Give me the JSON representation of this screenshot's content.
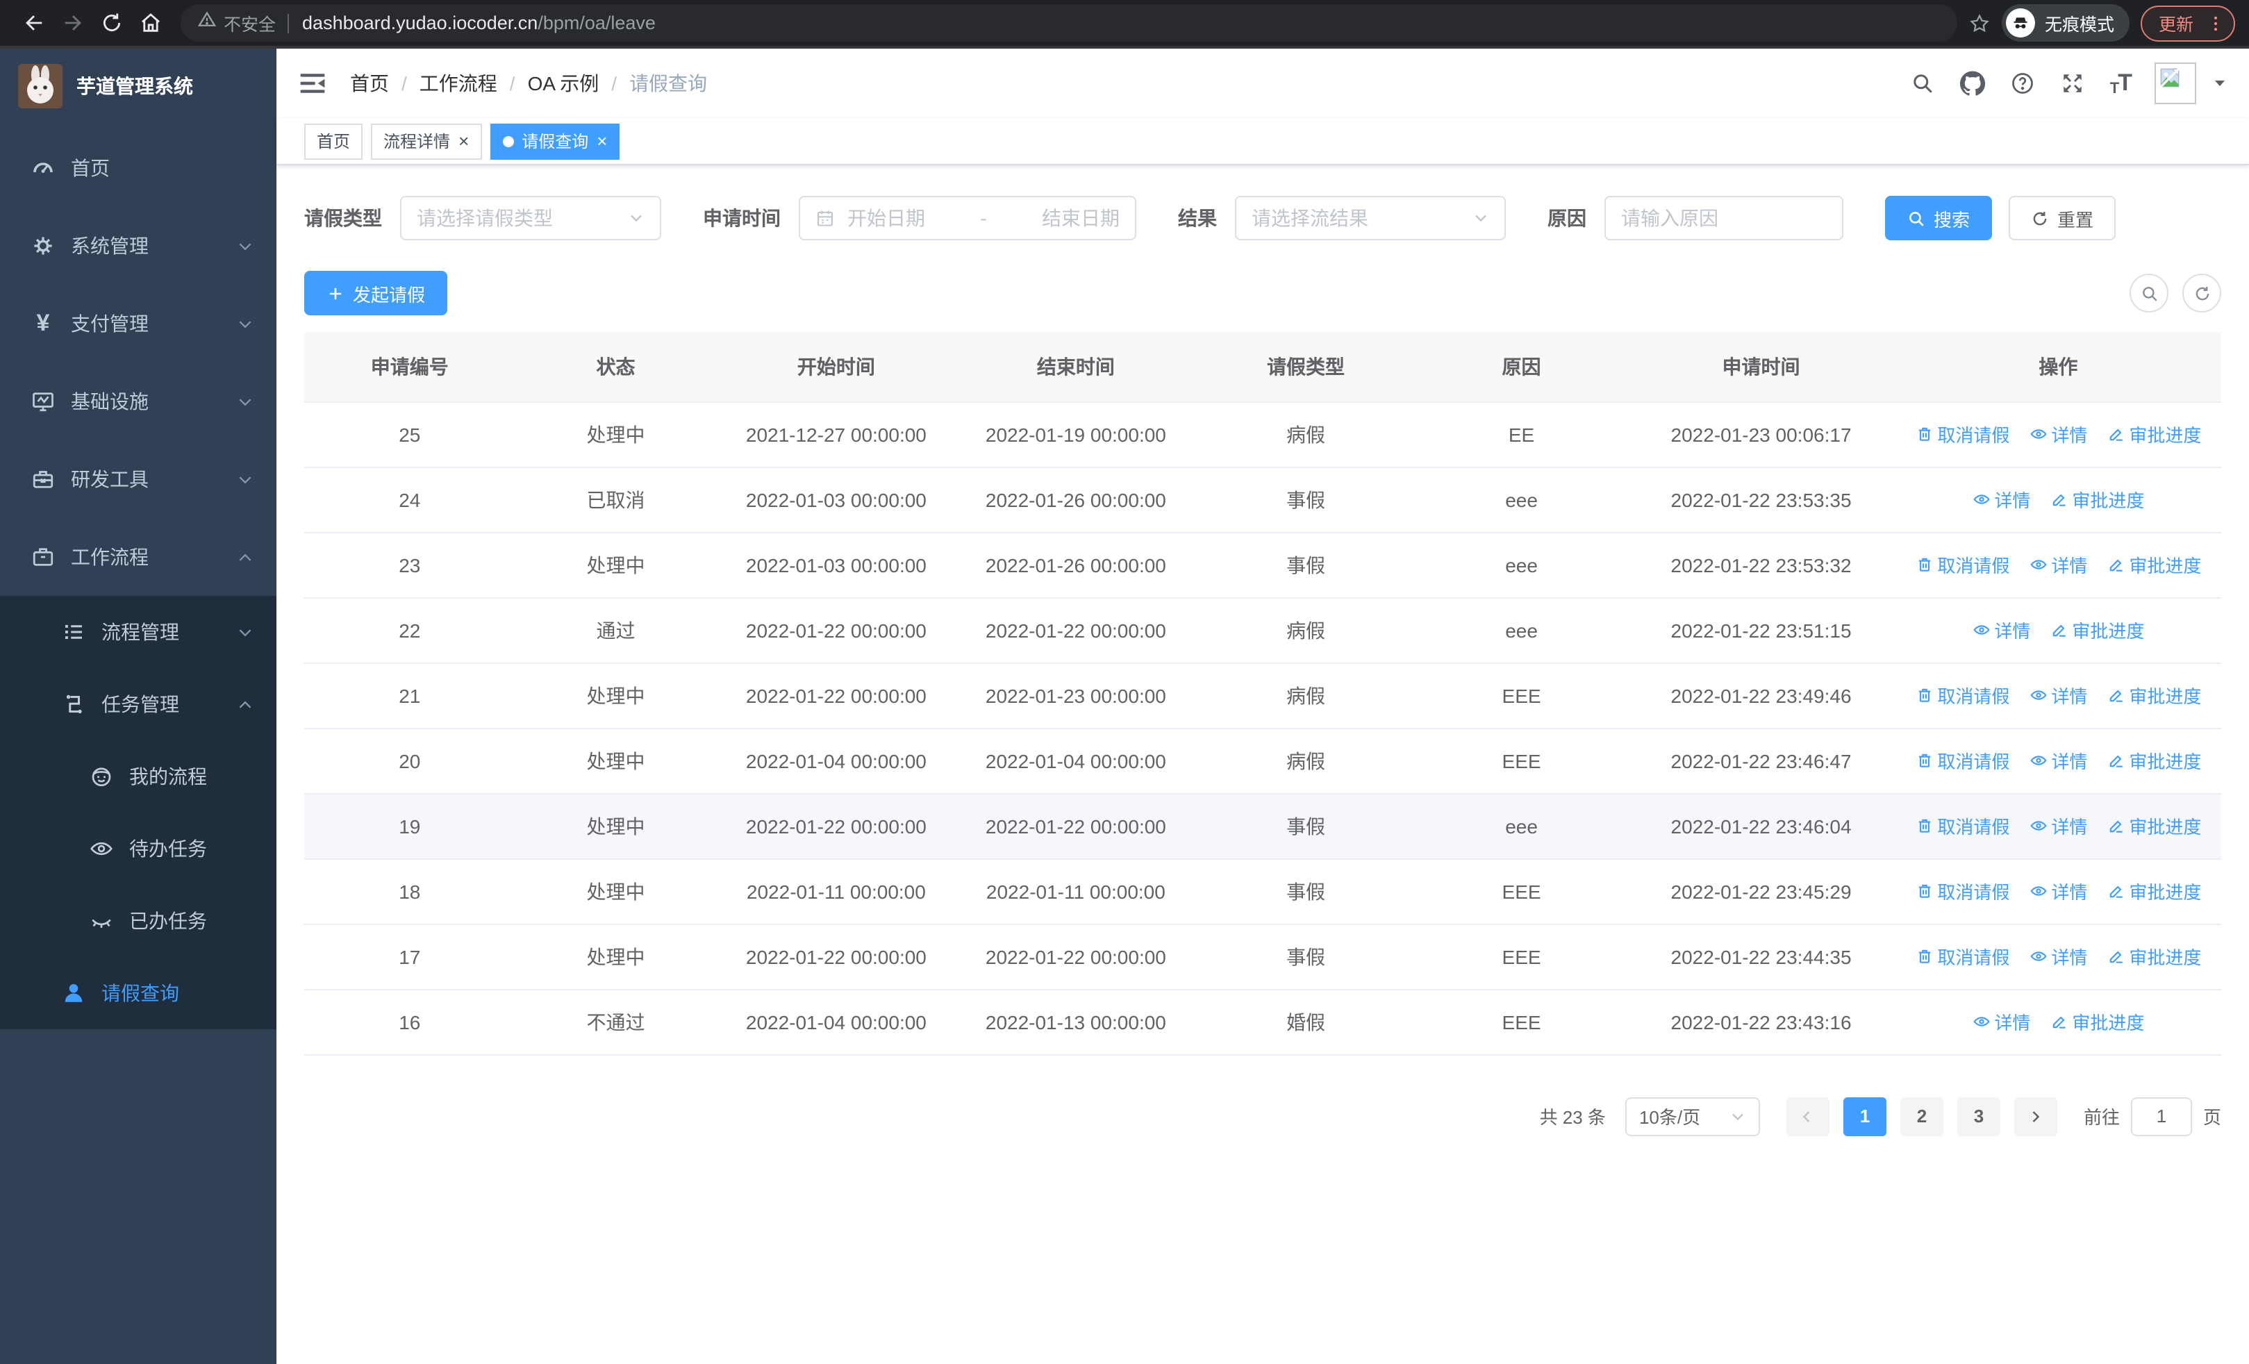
{
  "colors": {
    "accent": "#409eff",
    "sidebar_bg": "#304156",
    "submenu_bg": "#1f2d3d",
    "sidebar_text": "#bfcbd9"
  },
  "browser": {
    "security_label": "不安全",
    "url_host": "dashboard.yudao.iocoder.cn",
    "url_path": "/bpm/oa/leave",
    "incognito_label": "无痕模式",
    "update_label": "更新"
  },
  "sidebar": {
    "title": "芋道管理系统",
    "items": [
      {
        "id": "home",
        "label": "首页",
        "icon": "dashboard-icon",
        "level": 1,
        "sub": false,
        "chevron": "",
        "active": false
      },
      {
        "id": "system",
        "label": "系统管理",
        "icon": "gear-icon",
        "level": 1,
        "sub": false,
        "chevron": "down",
        "active": false
      },
      {
        "id": "payment",
        "label": "支付管理",
        "icon": "yen-icon",
        "level": 1,
        "sub": false,
        "chevron": "down",
        "active": false
      },
      {
        "id": "infra",
        "label": "基础设施",
        "icon": "monitor-icon",
        "level": 1,
        "sub": false,
        "chevron": "down",
        "active": false
      },
      {
        "id": "devtools",
        "label": "研发工具",
        "icon": "toolbox-icon",
        "level": 1,
        "sub": false,
        "chevron": "down",
        "active": false
      },
      {
        "id": "workflow",
        "label": "工作流程",
        "icon": "briefcase-icon",
        "level": 1,
        "sub": false,
        "chevron": "up",
        "active": false
      },
      {
        "id": "process-mgmt",
        "label": "流程管理",
        "icon": "list-icon",
        "level": 2,
        "sub": true,
        "chevron": "down",
        "active": false
      },
      {
        "id": "task-mgmt",
        "label": "任务管理",
        "icon": "flow-icon",
        "level": 2,
        "sub": true,
        "chevron": "up",
        "active": false
      },
      {
        "id": "my-process",
        "label": "我的流程",
        "icon": "face-icon",
        "level": 3,
        "sub": true,
        "chevron": "",
        "active": false
      },
      {
        "id": "todo-task",
        "label": "待办任务",
        "icon": "eye-open-icon",
        "level": 3,
        "sub": true,
        "chevron": "",
        "active": false
      },
      {
        "id": "done-task",
        "label": "已办任务",
        "icon": "eye-closed-icon",
        "level": 3,
        "sub": true,
        "chevron": "",
        "active": false
      },
      {
        "id": "leave-query",
        "label": "请假查询",
        "icon": "user-icon",
        "level": 2,
        "sub": true,
        "chevron": "",
        "active": true
      }
    ]
  },
  "navbar": {
    "breadcrumb": [
      "首页",
      "工作流程",
      "OA 示例",
      "请假查询"
    ],
    "breadcrumb_separator": "/"
  },
  "tags": {
    "tabs": [
      {
        "label": "首页",
        "active": false,
        "closable": false
      },
      {
        "label": "流程详情",
        "active": false,
        "closable": true
      },
      {
        "label": "请假查询",
        "active": true,
        "closable": true
      }
    ]
  },
  "filters": {
    "leave_type": {
      "label": "请假类型",
      "placeholder": "请选择请假类型"
    },
    "apply_time": {
      "label": "申请时间",
      "start_placeholder": "开始日期",
      "separator": "-",
      "end_placeholder": "结束日期"
    },
    "result": {
      "label": "结果",
      "placeholder": "请选择流结果"
    },
    "reason": {
      "label": "原因",
      "placeholder": "请输入原因"
    },
    "search_label": "搜索",
    "reset_label": "重置"
  },
  "toolbar": {
    "create_label": "发起请假"
  },
  "table": {
    "headers": [
      "申请编号",
      "状态",
      "开始时间",
      "结束时间",
      "请假类型",
      "原因",
      "申请时间",
      "操作"
    ],
    "action_labels": {
      "cancel": "取消请假",
      "detail": "详情",
      "progress": "审批进度"
    },
    "rows": [
      {
        "id": "25",
        "status": "处理中",
        "start": "2021-12-27 00:00:00",
        "end": "2022-01-19 00:00:00",
        "type": "病假",
        "reason": "EE",
        "applied": "2022-01-23 00:06:17",
        "actions": [
          "cancel",
          "detail",
          "progress"
        ],
        "highlight": false
      },
      {
        "id": "24",
        "status": "已取消",
        "start": "2022-01-03 00:00:00",
        "end": "2022-01-26 00:00:00",
        "type": "事假",
        "reason": "eee",
        "applied": "2022-01-22 23:53:35",
        "actions": [
          "detail",
          "progress"
        ],
        "highlight": false
      },
      {
        "id": "23",
        "status": "处理中",
        "start": "2022-01-03 00:00:00",
        "end": "2022-01-26 00:00:00",
        "type": "事假",
        "reason": "eee",
        "applied": "2022-01-22 23:53:32",
        "actions": [
          "cancel",
          "detail",
          "progress"
        ],
        "highlight": false
      },
      {
        "id": "22",
        "status": "通过",
        "start": "2022-01-22 00:00:00",
        "end": "2022-01-22 00:00:00",
        "type": "病假",
        "reason": "eee",
        "applied": "2022-01-22 23:51:15",
        "actions": [
          "detail",
          "progress"
        ],
        "highlight": false
      },
      {
        "id": "21",
        "status": "处理中",
        "start": "2022-01-22 00:00:00",
        "end": "2022-01-23 00:00:00",
        "type": "病假",
        "reason": "EEE",
        "applied": "2022-01-22 23:49:46",
        "actions": [
          "cancel",
          "detail",
          "progress"
        ],
        "highlight": false
      },
      {
        "id": "20",
        "status": "处理中",
        "start": "2022-01-04 00:00:00",
        "end": "2022-01-04 00:00:00",
        "type": "病假",
        "reason": "EEE",
        "applied": "2022-01-22 23:46:47",
        "actions": [
          "cancel",
          "detail",
          "progress"
        ],
        "highlight": false
      },
      {
        "id": "19",
        "status": "处理中",
        "start": "2022-01-22 00:00:00",
        "end": "2022-01-22 00:00:00",
        "type": "事假",
        "reason": "eee",
        "applied": "2022-01-22 23:46:04",
        "actions": [
          "cancel",
          "detail",
          "progress"
        ],
        "highlight": true
      },
      {
        "id": "18",
        "status": "处理中",
        "start": "2022-01-11 00:00:00",
        "end": "2022-01-11 00:00:00",
        "type": "事假",
        "reason": "EEE",
        "applied": "2022-01-22 23:45:29",
        "actions": [
          "cancel",
          "detail",
          "progress"
        ],
        "highlight": false
      },
      {
        "id": "17",
        "status": "处理中",
        "start": "2022-01-22 00:00:00",
        "end": "2022-01-22 00:00:00",
        "type": "事假",
        "reason": "EEE",
        "applied": "2022-01-22 23:44:35",
        "actions": [
          "cancel",
          "detail",
          "progress"
        ],
        "highlight": false
      },
      {
        "id": "16",
        "status": "不通过",
        "start": "2022-01-04 00:00:00",
        "end": "2022-01-13 00:00:00",
        "type": "婚假",
        "reason": "EEE",
        "applied": "2022-01-22 23:43:16",
        "actions": [
          "detail",
          "progress"
        ],
        "highlight": false
      }
    ],
    "column_widths": [
      "11%",
      "10.5%",
      "12.5%",
      "12.5%",
      "11.5%",
      "11%",
      "14%",
      "17%"
    ]
  },
  "pagination": {
    "total_label": "共 23 条",
    "page_size": "10条/页",
    "pages": [
      "1",
      "2",
      "3"
    ],
    "active_page": "1",
    "goto_label": "前往",
    "goto_value": "1",
    "page_suffix": "页"
  }
}
